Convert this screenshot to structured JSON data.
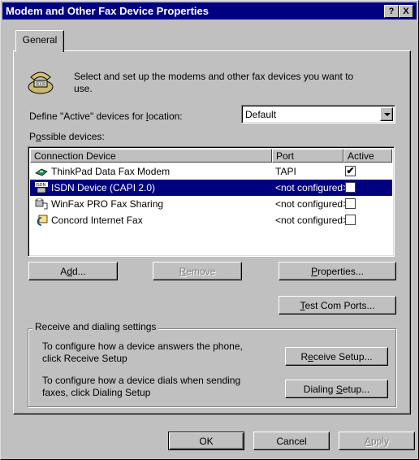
{
  "window": {
    "title": "Modem and Other Fax Device Properties",
    "help_glyph": "?",
    "close_glyph": "X"
  },
  "tab": {
    "label": "General"
  },
  "intro": {
    "line1": "Select and set up the modems and other fax devices you want to",
    "line2": "use."
  },
  "location": {
    "label_pre": "Define \"Active\" devices for ",
    "label_u": "l",
    "label_post": "ocation:",
    "value": "Default"
  },
  "possible": {
    "pre": "P",
    "u": "o",
    "post": "ssible devices:"
  },
  "list": {
    "columns": [
      "Connection Device",
      "Port",
      "Active"
    ],
    "rows": [
      {
        "name": "ThinkPad Data Fax Modem",
        "port": "TAPI",
        "active": "✔",
        "icon": "modem-icon"
      },
      {
        "name": "ISDN Device (CAPI 2.0)",
        "port": "<not configured>",
        "active": "",
        "icon": "isdn-icon"
      },
      {
        "name": "WinFax PRO Fax Sharing",
        "port": "<not configured>",
        "active": "",
        "icon": "winfax-icon"
      },
      {
        "name": "Concord Internet Fax",
        "port": "<not configured>",
        "active": "",
        "icon": "concord-icon"
      }
    ]
  },
  "buttons": {
    "add": {
      "pre": "A",
      "u": "d",
      "post": "d..."
    },
    "remove": {
      "pre": "",
      "u": "R",
      "post": "emove"
    },
    "properties": {
      "pre": "",
      "u": "P",
      "post": "roperties..."
    },
    "test": {
      "pre": "",
      "u": "T",
      "post": "est Com Ports..."
    },
    "receive": {
      "pre": "R",
      "u": "e",
      "post": "ceive Setup..."
    },
    "dialing": {
      "pre": "Dialing ",
      "u": "S",
      "post": "etup..."
    },
    "ok": "OK",
    "cancel": "Cancel",
    "apply": {
      "pre": "",
      "u": "A",
      "post": "pply"
    }
  },
  "group": {
    "title": "Receive and dialing settings",
    "receive_line1": "To configure how a device answers the phone,",
    "receive_line2": "click Receive Setup",
    "dialing_line1": "To configure how a device dials when sending",
    "dialing_line2": "faxes, click Dialing Setup"
  },
  "colors": {
    "titlebar": "#000080",
    "face": "#c0c0c0",
    "selection": "#000080"
  }
}
